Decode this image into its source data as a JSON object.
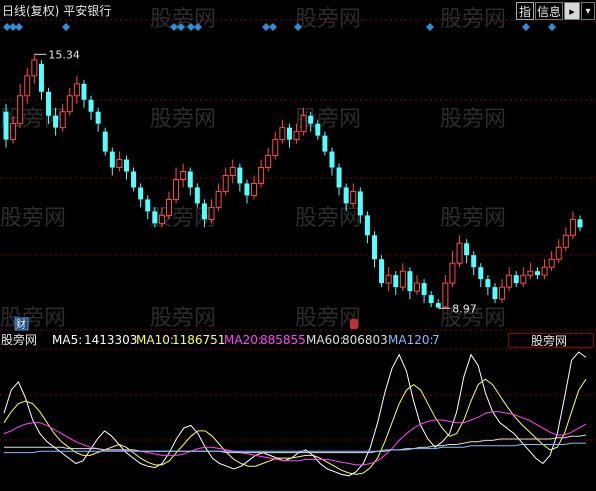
{
  "header": {
    "period_adj": "日线(复权)",
    "stock_name": "平安银行",
    "btn_index": "指",
    "btn_info": "信息"
  },
  "watermark": "股旁网",
  "markers": {
    "high_label": "15.34",
    "low_label": "8.97",
    "finance_badge": "财"
  },
  "indicator_bar": {
    "name": "股旁网",
    "ma5_label": "MA5:",
    "ma5_value": "1413303",
    "ma10_label": "MA10:",
    "ma10_value": "1186751",
    "ma20_label": "MA20:",
    "ma20_value": "885855",
    "ma60_label": "MA60:",
    "ma60_value": "806803",
    "ma120_label": "MA120:",
    "ma120_value": "7",
    "dropdown_label": "股旁网"
  },
  "colors": {
    "up": "#ff4a4a",
    "down": "#54ffff",
    "grid": "#7a0000",
    "ma5": "#ffffff",
    "ma10": "#ffff55",
    "ma20": "#ff44ff",
    "ma60": "#dddddd",
    "ma120": "#88bbff",
    "diamond": "#2e8fd6"
  },
  "chart_data": {
    "type": "candlestick",
    "price_axis_ylim": [
      8.5,
      16.1
    ],
    "annotated_high": 15.34,
    "annotated_low": 8.97,
    "candles": [
      [
        13.9,
        13.2,
        14.1,
        13.0
      ],
      [
        13.2,
        13.6,
        13.8,
        13.1
      ],
      [
        13.6,
        14.3,
        14.6,
        13.5
      ],
      [
        14.3,
        14.8,
        15.0,
        14.1
      ],
      [
        14.8,
        15.2,
        15.34,
        14.6
      ],
      [
        15.1,
        14.4,
        15.2,
        14.2
      ],
      [
        14.4,
        13.8,
        14.5,
        13.6
      ],
      [
        13.8,
        13.5,
        14.0,
        13.3
      ],
      [
        13.5,
        13.9,
        14.1,
        13.4
      ],
      [
        13.9,
        14.3,
        14.5,
        13.8
      ],
      [
        14.3,
        14.6,
        14.8,
        14.1
      ],
      [
        14.6,
        14.2,
        14.7,
        14.0
      ],
      [
        14.2,
        13.9,
        14.3,
        13.7
      ],
      [
        13.9,
        13.6,
        14.0,
        13.4
      ],
      [
        13.4,
        12.9,
        13.5,
        12.8
      ],
      [
        12.9,
        12.5,
        13.0,
        12.3
      ],
      [
        12.5,
        12.7,
        12.9,
        12.4
      ],
      [
        12.7,
        12.4,
        12.8,
        12.2
      ],
      [
        12.4,
        12.0,
        12.5,
        11.9
      ],
      [
        12.0,
        11.7,
        12.1,
        11.5
      ],
      [
        11.7,
        11.4,
        11.8,
        11.2
      ],
      [
        11.4,
        11.1,
        11.5,
        11.0
      ],
      [
        11.1,
        11.3,
        11.5,
        11.0
      ],
      [
        11.3,
        11.7,
        11.9,
        11.2
      ],
      [
        11.7,
        12.2,
        12.5,
        11.6
      ],
      [
        12.2,
        12.4,
        12.6,
        12.0
      ],
      [
        12.4,
        12.0,
        12.5,
        11.8
      ],
      [
        12.0,
        11.6,
        12.1,
        11.5
      ],
      [
        11.6,
        11.2,
        11.7,
        11.0
      ],
      [
        11.2,
        11.5,
        11.7,
        11.1
      ],
      [
        11.5,
        11.9,
        12.1,
        11.4
      ],
      [
        11.9,
        12.3,
        12.5,
        11.8
      ],
      [
        12.3,
        12.5,
        12.7,
        12.1
      ],
      [
        12.5,
        12.1,
        12.6,
        11.9
      ],
      [
        12.1,
        11.8,
        12.2,
        11.6
      ],
      [
        11.8,
        12.1,
        12.3,
        11.7
      ],
      [
        12.1,
        12.5,
        12.7,
        12.0
      ],
      [
        12.5,
        12.8,
        13.0,
        12.4
      ],
      [
        12.8,
        13.2,
        13.4,
        12.7
      ],
      [
        13.2,
        13.5,
        13.7,
        13.1
      ],
      [
        13.5,
        13.2,
        13.6,
        13.0
      ],
      [
        13.2,
        13.4,
        13.6,
        13.1
      ],
      [
        13.4,
        13.8,
        14.0,
        13.3
      ],
      [
        13.8,
        13.6,
        13.9,
        13.4
      ],
      [
        13.6,
        13.3,
        13.7,
        13.2
      ],
      [
        13.3,
        12.9,
        13.4,
        12.8
      ],
      [
        12.9,
        12.5,
        13.0,
        12.3
      ],
      [
        12.5,
        12.0,
        12.6,
        11.8
      ],
      [
        12.0,
        11.6,
        12.1,
        11.4
      ],
      [
        11.6,
        11.9,
        12.1,
        11.5
      ],
      [
        11.9,
        11.3,
        12.0,
        11.1
      ],
      [
        11.3,
        10.8,
        11.4,
        10.6
      ],
      [
        10.8,
        10.2,
        10.9,
        10.0
      ],
      [
        10.2,
        9.6,
        10.3,
        9.5
      ],
      [
        9.6,
        9.8,
        10.0,
        9.4
      ],
      [
        9.8,
        9.5,
        9.9,
        9.3
      ],
      [
        9.5,
        9.9,
        10.1,
        9.4
      ],
      [
        9.9,
        9.4,
        10.0,
        9.2
      ],
      [
        9.4,
        9.6,
        9.8,
        9.3
      ],
      [
        9.6,
        9.3,
        9.7,
        9.1
      ],
      [
        9.3,
        9.1,
        9.4,
        9.0
      ],
      [
        9.1,
        8.99,
        9.2,
        8.97
      ],
      [
        9.0,
        9.6,
        9.8,
        8.98
      ],
      [
        9.6,
        10.1,
        10.4,
        9.5
      ],
      [
        10.1,
        10.6,
        10.8,
        10.0
      ],
      [
        10.6,
        10.3,
        10.7,
        10.1
      ],
      [
        10.3,
        10.0,
        10.4,
        9.8
      ],
      [
        10.0,
        9.7,
        10.1,
        9.5
      ],
      [
        9.7,
        9.5,
        9.8,
        9.3
      ],
      [
        9.5,
        9.2,
        9.6,
        9.1
      ],
      [
        9.2,
        9.5,
        9.7,
        9.1
      ],
      [
        9.5,
        9.8,
        10.0,
        9.4
      ],
      [
        9.8,
        9.6,
        9.9,
        9.5
      ],
      [
        9.6,
        9.8,
        10.0,
        9.5
      ],
      [
        9.8,
        9.9,
        10.1,
        9.7
      ],
      [
        9.9,
        9.8,
        10.0,
        9.7
      ],
      [
        9.8,
        10.0,
        10.2,
        9.7
      ],
      [
        10.0,
        10.2,
        10.4,
        9.9
      ],
      [
        10.2,
        10.5,
        10.7,
        10.1
      ],
      [
        10.5,
        10.8,
        11.0,
        10.4
      ],
      [
        10.8,
        11.2,
        11.4,
        10.7
      ],
      [
        11.2,
        11.0,
        11.3,
        10.9
      ]
    ],
    "indicator_series": [
      {
        "name": "MA5",
        "values": [
          0.55,
          0.72,
          0.78,
          0.66,
          0.5,
          0.4,
          0.34,
          0.3,
          0.26,
          0.22,
          0.18,
          0.2,
          0.28,
          0.36,
          0.42,
          0.38,
          0.32,
          0.26,
          0.22,
          0.18,
          0.16,
          0.15,
          0.18,
          0.26,
          0.36,
          0.44,
          0.46,
          0.4,
          0.3,
          0.22,
          0.18,
          0.16,
          0.14,
          0.16,
          0.2,
          0.24,
          0.26,
          0.24,
          0.22,
          0.2,
          0.22,
          0.26,
          0.28,
          0.24,
          0.18,
          0.14,
          0.12,
          0.1,
          0.09,
          0.12,
          0.18,
          0.3,
          0.48,
          0.7,
          0.88,
          0.98,
          0.86,
          0.64,
          0.46,
          0.36,
          0.3,
          0.34,
          0.4,
          0.56,
          0.82,
          0.98,
          0.9,
          0.7,
          0.56,
          0.48,
          0.44,
          0.4,
          0.34,
          0.28,
          0.22,
          0.18,
          0.24,
          0.4,
          0.66,
          0.94,
          1.0,
          0.96
        ]
      },
      {
        "name": "MA10",
        "values": [
          0.48,
          0.56,
          0.62,
          0.64,
          0.62,
          0.56,
          0.48,
          0.4,
          0.34,
          0.3,
          0.26,
          0.24,
          0.24,
          0.26,
          0.28,
          0.3,
          0.32,
          0.3,
          0.26,
          0.22,
          0.19,
          0.17,
          0.17,
          0.2,
          0.26,
          0.32,
          0.38,
          0.42,
          0.42,
          0.38,
          0.32,
          0.26,
          0.21,
          0.18,
          0.16,
          0.16,
          0.18,
          0.2,
          0.22,
          0.22,
          0.22,
          0.23,
          0.24,
          0.24,
          0.22,
          0.19,
          0.16,
          0.13,
          0.11,
          0.1,
          0.11,
          0.15,
          0.22,
          0.34,
          0.48,
          0.62,
          0.72,
          0.76,
          0.72,
          0.62,
          0.52,
          0.44,
          0.38,
          0.4,
          0.5,
          0.64,
          0.76,
          0.8,
          0.76,
          0.68,
          0.6,
          0.53,
          0.47,
          0.42,
          0.37,
          0.32,
          0.28,
          0.3,
          0.4,
          0.56,
          0.72,
          0.8
        ]
      },
      {
        "name": "MA20",
        "values": [
          0.4,
          0.42,
          0.45,
          0.47,
          0.48,
          0.48,
          0.46,
          0.43,
          0.4,
          0.37,
          0.34,
          0.32,
          0.3,
          0.29,
          0.28,
          0.28,
          0.28,
          0.28,
          0.28,
          0.27,
          0.26,
          0.25,
          0.24,
          0.24,
          0.24,
          0.25,
          0.27,
          0.29,
          0.3,
          0.3,
          0.29,
          0.28,
          0.27,
          0.26,
          0.25,
          0.24,
          0.23,
          0.22,
          0.21,
          0.2,
          0.2,
          0.2,
          0.21,
          0.21,
          0.21,
          0.21,
          0.2,
          0.19,
          0.18,
          0.17,
          0.17,
          0.18,
          0.2,
          0.24,
          0.29,
          0.35,
          0.4,
          0.44,
          0.47,
          0.49,
          0.5,
          0.5,
          0.49,
          0.48,
          0.48,
          0.5,
          0.52,
          0.55,
          0.56,
          0.56,
          0.55,
          0.54,
          0.52,
          0.5,
          0.47,
          0.44,
          0.41,
          0.39,
          0.39,
          0.41,
          0.44,
          0.47
        ]
      },
      {
        "name": "MA60",
        "values": [
          0.3,
          0.3,
          0.3,
          0.3,
          0.3,
          0.3,
          0.3,
          0.3,
          0.3,
          0.29,
          0.29,
          0.29,
          0.29,
          0.29,
          0.28,
          0.28,
          0.28,
          0.28,
          0.28,
          0.27,
          0.27,
          0.27,
          0.27,
          0.27,
          0.27,
          0.27,
          0.27,
          0.27,
          0.27,
          0.27,
          0.27,
          0.26,
          0.26,
          0.26,
          0.26,
          0.26,
          0.26,
          0.26,
          0.26,
          0.26,
          0.26,
          0.26,
          0.26,
          0.26,
          0.26,
          0.26,
          0.26,
          0.26,
          0.26,
          0.26,
          0.26,
          0.26,
          0.27,
          0.27,
          0.28,
          0.28,
          0.29,
          0.29,
          0.3,
          0.3,
          0.31,
          0.31,
          0.32,
          0.32,
          0.33,
          0.34,
          0.34,
          0.35,
          0.35,
          0.36,
          0.36,
          0.36,
          0.36,
          0.36,
          0.36,
          0.36,
          0.36,
          0.37,
          0.37,
          0.38,
          0.38,
          0.39
        ]
      },
      {
        "name": "MA120",
        "values": [
          0.26,
          0.26,
          0.26,
          0.26,
          0.26,
          0.27,
          0.27,
          0.27,
          0.27,
          0.27,
          0.27,
          0.27,
          0.27,
          0.27,
          0.27,
          0.27,
          0.27,
          0.27,
          0.27,
          0.27,
          0.27,
          0.27,
          0.27,
          0.27,
          0.27,
          0.27,
          0.27,
          0.27,
          0.27,
          0.27,
          0.27,
          0.27,
          0.27,
          0.27,
          0.27,
          0.27,
          0.27,
          0.27,
          0.27,
          0.27,
          0.27,
          0.27,
          0.27,
          0.27,
          0.27,
          0.27,
          0.27,
          0.27,
          0.27,
          0.27,
          0.27,
          0.27,
          0.27,
          0.28,
          0.28,
          0.28,
          0.28,
          0.29,
          0.29,
          0.29,
          0.29,
          0.3,
          0.3,
          0.3,
          0.3,
          0.31,
          0.31,
          0.31,
          0.31,
          0.31,
          0.31,
          0.31,
          0.32,
          0.32,
          0.32,
          0.32,
          0.32,
          0.32,
          0.32,
          0.33,
          0.33,
          0.33
        ]
      }
    ]
  }
}
